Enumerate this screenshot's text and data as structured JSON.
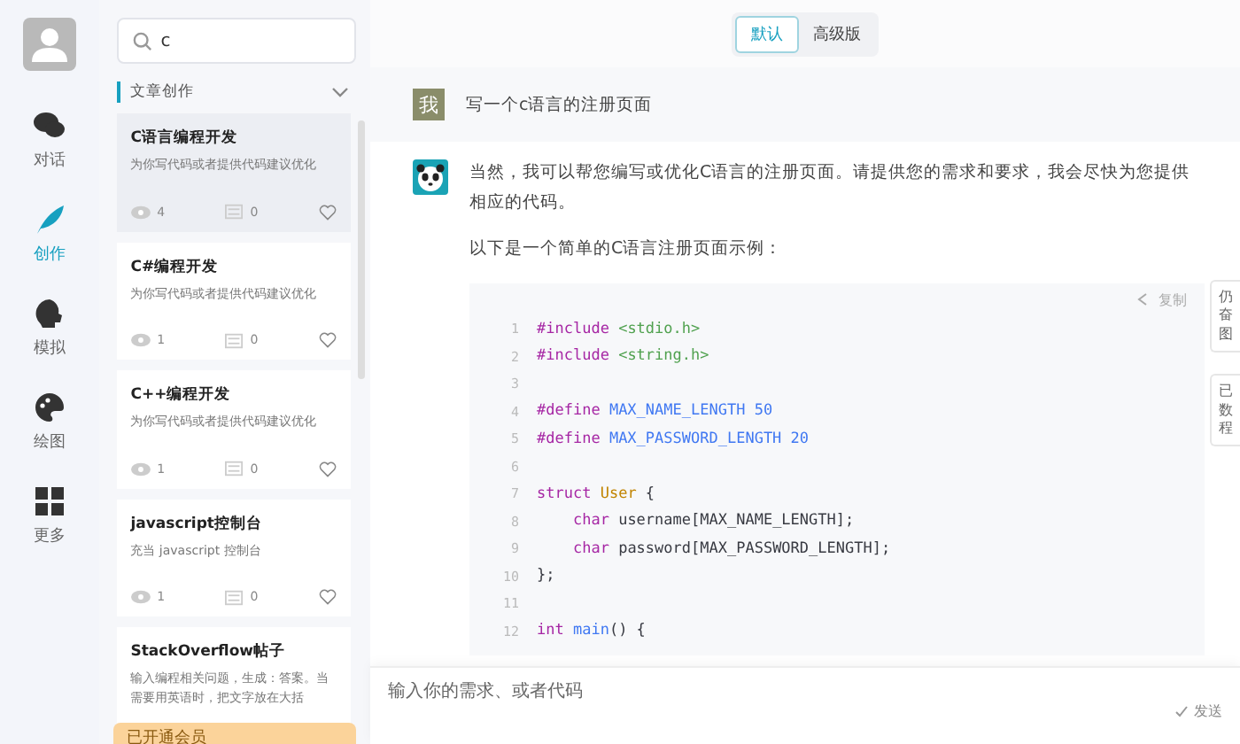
{
  "nav": [
    {
      "label": "对话",
      "kind": "chat",
      "selected": false
    },
    {
      "label": "创作",
      "kind": "feather",
      "selected": true
    },
    {
      "label": "模拟",
      "kind": "head",
      "selected": false
    },
    {
      "label": "绘图",
      "kind": "palette",
      "selected": false
    },
    {
      "label": "更多",
      "kind": "grid",
      "selected": false
    }
  ],
  "search": {
    "value": "c"
  },
  "section": {
    "title": "文章创作",
    "expanded": true
  },
  "cards": [
    {
      "title": "C语言编程开发",
      "desc": "为你写代码或者提供代码建议优化",
      "views": "4",
      "comments": "0",
      "selected": true
    },
    {
      "title": "C#编程开发",
      "desc": "为你写代码或者提供代码建议优化",
      "views": "1",
      "comments": "0",
      "selected": false
    },
    {
      "title": "C++编程开发",
      "desc": "为你写代码或者提供代码建议优化",
      "views": "1",
      "comments": "0",
      "selected": false
    },
    {
      "title": "javascript控制台",
      "desc": "充当 javascript 控制台",
      "views": "1",
      "comments": "0",
      "selected": false
    },
    {
      "title": "StackOverflow帖子",
      "desc": "输入编程相关问题，生成：答案。当需要用英语时，把文字放在大括",
      "selected": false
    }
  ],
  "member_bar": {
    "label": "已开通会员"
  },
  "modes": [
    {
      "label": "默认",
      "selected": true
    },
    {
      "label": "高级版",
      "selected": false
    }
  ],
  "user_message": {
    "avatar": "我",
    "text": "写一个c语言的注册页面"
  },
  "reply": {
    "paragraphs": [
      "当然，我可以帮您编写或优化C语言的注册页面。请提供您的需求和要求，我会尽快为您提供相应的代码。",
      "以下是一个简单的C语言注册页面示例："
    ],
    "copy_label": "复制",
    "code": [
      {
        "num": "1",
        "tokens": [
          {
            "kind": "directive",
            "text": "#include"
          },
          {
            "kind": "string",
            "text": " <stdio.h>"
          }
        ]
      },
      {
        "num": "2",
        "tokens": [
          {
            "kind": "directive",
            "text": "#include"
          },
          {
            "kind": "string",
            "text": " <string.h>"
          }
        ]
      },
      {
        "num": "3"
      },
      {
        "num": "4",
        "tokens": [
          {
            "kind": "directive",
            "text": "#define"
          },
          {
            "kind": "macro",
            "text": " MAX_NAME_LENGTH 50"
          }
        ]
      },
      {
        "num": "5",
        "tokens": [
          {
            "kind": "directive",
            "text": "#define"
          },
          {
            "kind": "macro",
            "text": " MAX_PASSWORD_LENGTH 20"
          }
        ]
      },
      {
        "num": "6"
      },
      {
        "num": "7",
        "tokens": [
          {
            "kind": "keyword",
            "text": "struct"
          },
          {
            "kind": "type",
            "text": " User"
          },
          {
            "kind": "plain",
            "text": " {"
          }
        ]
      },
      {
        "num": "8",
        "tokens": [
          {
            "kind": "keyword",
            "text": "    char"
          },
          {
            "kind": "plain",
            "text": " username[MAX_NAME_LENGTH];"
          }
        ]
      },
      {
        "num": "9",
        "tokens": [
          {
            "kind": "keyword",
            "text": "    char"
          },
          {
            "kind": "plain",
            "text": " password[MAX_PASSWORD_LENGTH];"
          }
        ]
      },
      {
        "num": "10",
        "tokens": [
          {
            "kind": "plain",
            "text": "};"
          }
        ]
      },
      {
        "num": "11"
      },
      {
        "num": "12",
        "tokens": [
          {
            "kind": "keyword",
            "text": "int"
          },
          {
            "kind": "func",
            "text": " main"
          },
          {
            "kind": "plain",
            "text": "() {"
          }
        ]
      }
    ]
  },
  "side_cards": [
    {
      "lines": [
        "仍",
        "奋",
        "图"
      ]
    },
    {
      "lines": [
        "已",
        "数",
        "程"
      ]
    }
  ],
  "input": {
    "placeholder": "输入你的需求、或者代码",
    "send_label": "发送"
  }
}
